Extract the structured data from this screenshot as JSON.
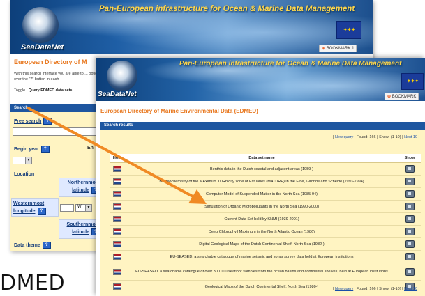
{
  "back_window": {
    "banner_title": "Pan-European infrastructure for Ocean & Marine Data Management",
    "logo_text": "SeaDataNet",
    "bookmark_label": "BOOKMARK",
    "bookmark_extra": "1",
    "page_heading": "European Directory of M",
    "intro_text": "With this search interface you are able to ... option hover over the \"?\" button in each",
    "toggle_prefix": "Toggle :",
    "toggle_link": "Query EDMED data sets",
    "search_header": "Search",
    "free_search_label": "Free search",
    "help_icon": "?",
    "begin_year_label": "Begin year",
    "end_fragment": "En",
    "location_label": "Location",
    "northernmost_label": "Northernmost latitude",
    "westernmost_label": "Westernmost longitude",
    "west_value": "W",
    "southernmost_label": "Southernmost latitude",
    "data_theme_label": "Data theme"
  },
  "front_window": {
    "banner_title": "Pan-European infrastructure for Ocean & Marine Data Management",
    "logo_text": "SeaDataNet",
    "bookmark_label": "BOOKMARK",
    "page_heading": "European Directory of Marine Environmental Data (EDMED)",
    "results_header": "Search results",
    "pager": {
      "new_query": "New query",
      "found": "Found: 166",
      "show": "Show: (1-10)",
      "next": "Next 10"
    },
    "table": {
      "headers": [
        "Host",
        "Data set name",
        "Show"
      ],
      "rows": [
        {
          "name": "Benthic data in the Dutch coastal and adjacent areas (1959-)"
        },
        {
          "name": "Biogeochemistry of the MAximum TURbidity zone of Estuaries (MATURE) in the Elbe, Gironde and Schelde (1993-1994)"
        },
        {
          "name": "Computer Model of Suspended Matter in the North Sea (1985-94)"
        },
        {
          "name": "Simulation of Organic Micropollutants in the North Sea (1990-2000)"
        },
        {
          "name": "Current Data Set held by KNMI (1939-2001)"
        },
        {
          "name": "Deep Chlorophyll Maximum in the North Atlantic Ocean (1986)"
        },
        {
          "name": "Digital Geological Maps of the Dutch Continental Shelf, North Sea (1982-)"
        },
        {
          "name": "EU-SEASED, a searchable catalogue of marine seismic and sonar survey data held at European institutions"
        },
        {
          "name": "EU-SEASED, a searchable catalogue of over 300.000 seafloor samples from the ocean basins and continental shelves, held at European institutions"
        },
        {
          "name": "Geological Maps of the Dutch Continental Shelf, North Sea (1980-)"
        }
      ]
    }
  },
  "caption": "DMED",
  "colors": {
    "heading_orange": "#e8761c",
    "bar_blue": "#1e56a0",
    "panel_yellow": "#fff4c2",
    "arrow_orange": "#f08a24"
  }
}
